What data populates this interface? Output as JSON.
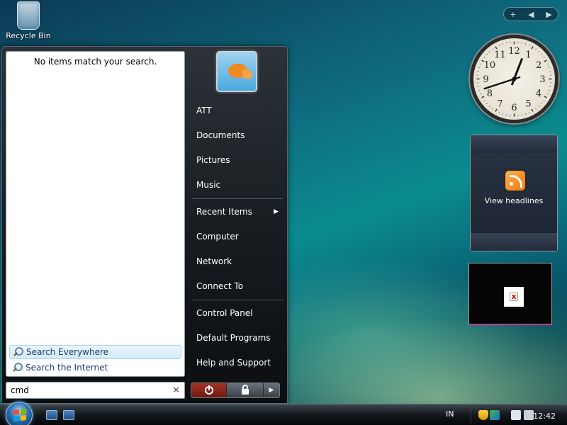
{
  "desktop": {
    "recycle_bin_label": "Recycle Bin"
  },
  "start_menu": {
    "no_results_text": "No items match your search.",
    "search_links": [
      {
        "label": "Search Everywhere"
      },
      {
        "label": "Search the Internet"
      }
    ],
    "search_value": "cmd",
    "clear_glyph": "✕",
    "right_items": [
      {
        "label": "ATT"
      },
      {
        "label": "Documents"
      },
      {
        "label": "Pictures"
      },
      {
        "label": "Music"
      },
      {
        "label": "Recent Items"
      },
      {
        "label": "Computer"
      },
      {
        "label": "Network"
      },
      {
        "label": "Connect To"
      },
      {
        "label": "Control Panel"
      },
      {
        "label": "Default Programs"
      },
      {
        "label": "Help and Support"
      }
    ],
    "arrow_glyph": "▶"
  },
  "sidebar": {
    "add_glyph": "+",
    "prev_glyph": "◀",
    "next_glyph": "▶"
  },
  "clock": {
    "numerals": [
      "12",
      "1",
      "2",
      "3",
      "4",
      "5",
      "6",
      "7",
      "8",
      "9",
      "10",
      "11"
    ],
    "hour": 12,
    "minute": 42
  },
  "feed": {
    "label": "View headlines"
  },
  "taskbar": {
    "language": "IN",
    "time": "12:42"
  },
  "colors": {
    "accent": "#1a3a7a",
    "power_red": "#a33228",
    "rss_orange": "#f07a10"
  }
}
